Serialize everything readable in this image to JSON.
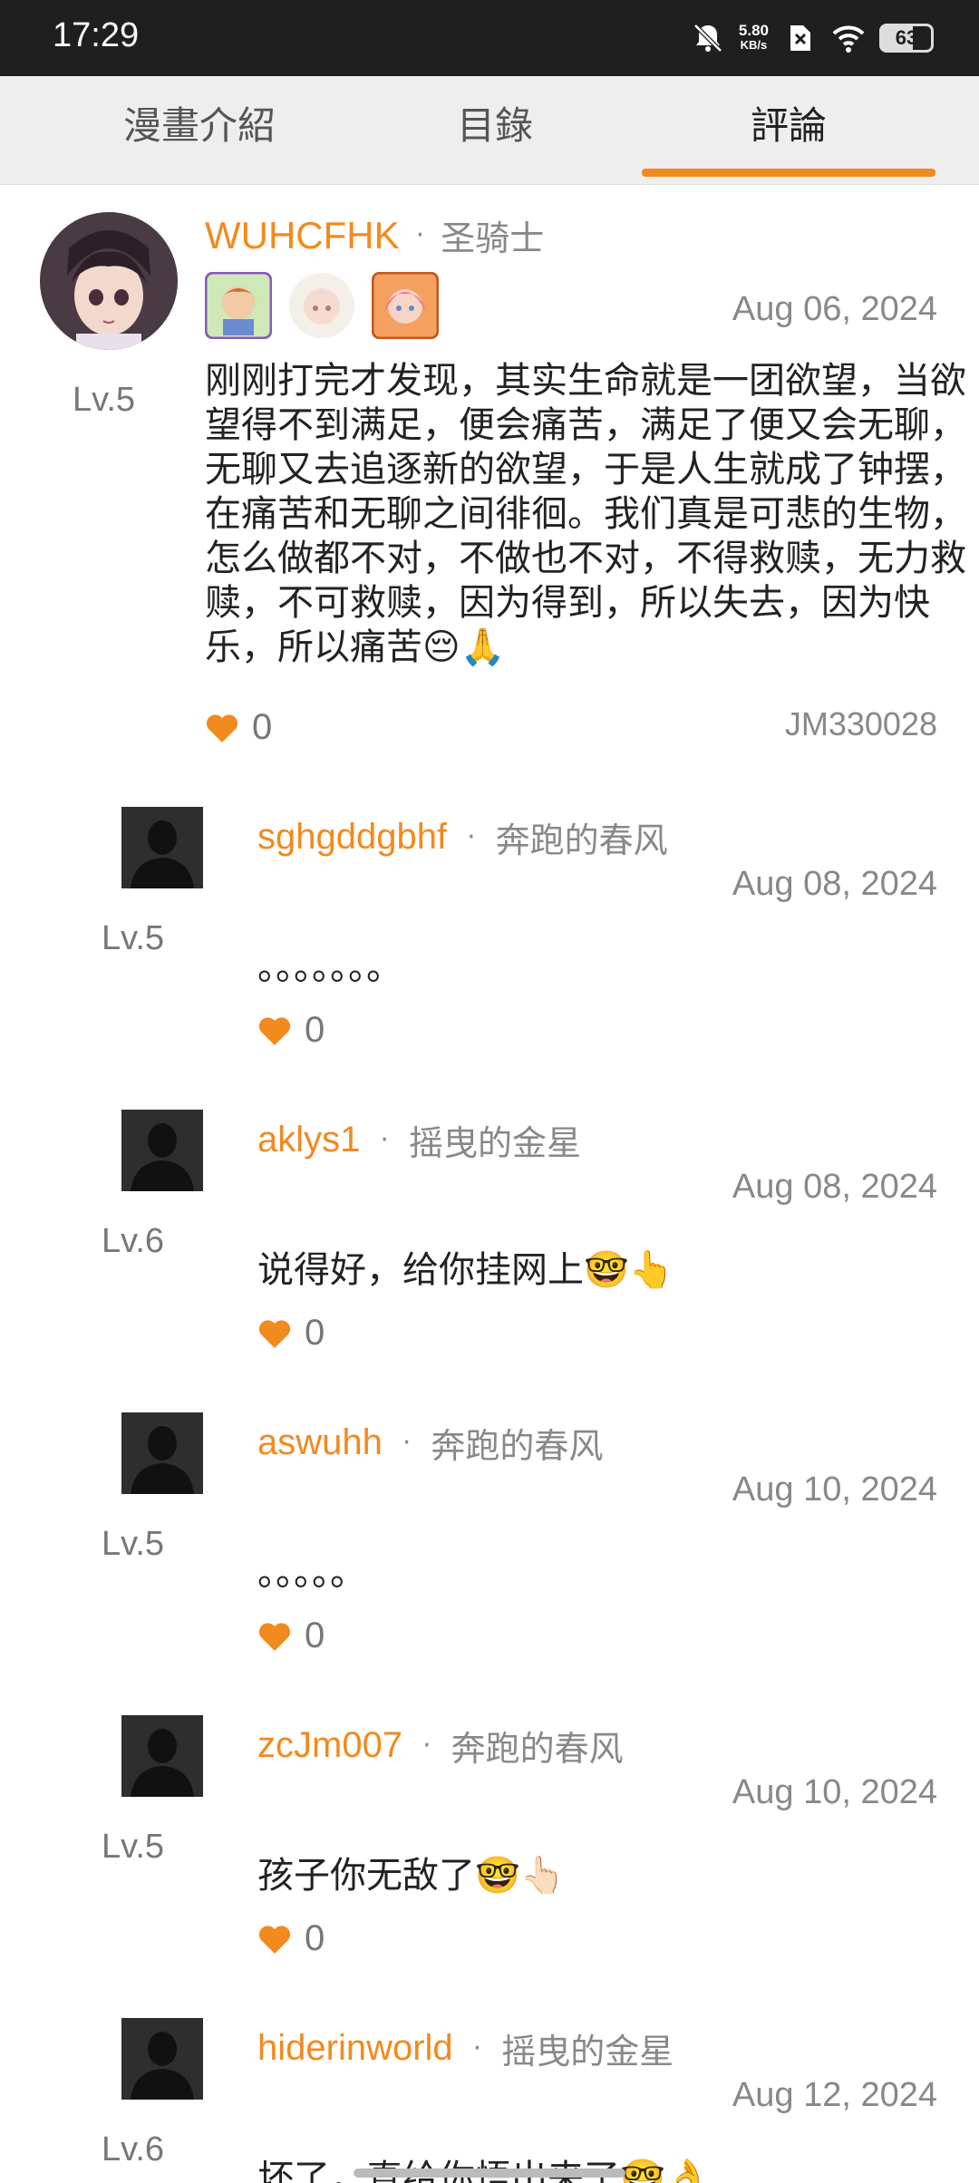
{
  "status_bar": {
    "time": "17:29",
    "net_speed_value": "5.80",
    "net_speed_unit": "KB/s",
    "battery": "63"
  },
  "tabs": [
    {
      "label": "漫畫介紹"
    },
    {
      "label": "目錄"
    },
    {
      "label": "評論"
    }
  ],
  "main_comment": {
    "username": "WUHCFHK",
    "rank": "圣骑士",
    "level": "Lv.5",
    "date": "Aug 06, 2024",
    "text": "刚刚打完才发现，其实生命就是一团欲望，当欲望得不到满足，便会痛苦，满足了便又会无聊，无聊又去追逐新的欲望，于是人生就成了钟摆，在痛苦和无聊之间徘徊。我们真是可悲的生物，怎么做都不对，不做也不对，不得救赎，无力救赎，不可救赎，因为得到，所以失去，因为快乐，所以痛苦😔🙏",
    "likes": "0",
    "comic_id": "JM330028"
  },
  "replies": [
    {
      "username": "sghgddgbhf",
      "rank": "奔跑的春风",
      "level": "Lv.5",
      "date": "Aug 08, 2024",
      "text": "。。。。。。。",
      "likes": "0"
    },
    {
      "username": "aklys1",
      "rank": "摇曳的金星",
      "level": "Lv.6",
      "date": "Aug 08, 2024",
      "text": "说得好，给你挂网上🤓👆",
      "likes": "0"
    },
    {
      "username": "aswuhh",
      "rank": "奔跑的春风",
      "level": "Lv.5",
      "date": "Aug 10, 2024",
      "text": "。。。。。",
      "likes": "0"
    },
    {
      "username": "zcJm007",
      "rank": "奔跑的春风",
      "level": "Lv.5",
      "date": "Aug 10, 2024",
      "text": "孩子你无敌了🤓👆🏻",
      "likes": "0"
    },
    {
      "username": "hiderinworld",
      "rank": "摇曳的金星",
      "level": "Lv.6",
      "date": "Aug 12, 2024",
      "text": "坏了，真给你悟出来了🤓👌",
      "likes": ""
    }
  ],
  "colors": {
    "accent": "#f28a1e",
    "statusbar": "#1f1f1f",
    "tabbar": "#eeeeee"
  }
}
